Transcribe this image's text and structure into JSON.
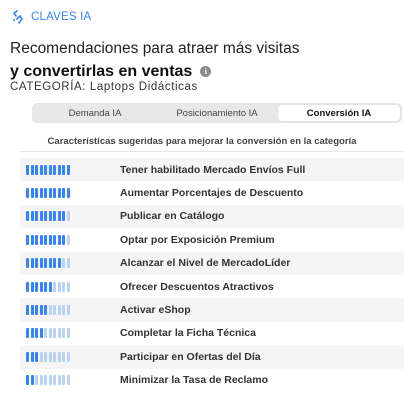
{
  "brand": {
    "label": "CLAVES IA",
    "icon": "ai-sparkle-icon",
    "color": "#3483fa"
  },
  "header": {
    "title_line1": "Recomendaciones para atraer más visitas",
    "title_line2": "y convertirlas en ventas",
    "info_icon": "info-icon"
  },
  "category": {
    "prefix": "CATEGORÍA:",
    "value": "Laptops Didácticas"
  },
  "tabs": [
    {
      "label": "Demanda IA",
      "active": false
    },
    {
      "label": "Posicionamiento IA",
      "active": false
    },
    {
      "label": "Conversión IA",
      "active": true
    }
  ],
  "section": {
    "subtitle": "Características sugeridas para mejorar la conversión en la categoría"
  },
  "bar_total": 10,
  "recommendations": [
    {
      "label": "Tener habilitado Mercado Envíos Full",
      "level": 10
    },
    {
      "label": "Aumentar Porcentajes de Descuento",
      "level": 10
    },
    {
      "label": "Publicar en Catálogo",
      "level": 9
    },
    {
      "label": "Optar por Exposición Premium",
      "level": 9
    },
    {
      "label": "Alcanzar el Nivel de MercadoLíder",
      "level": 8
    },
    {
      "label": "Ofrecer Descuentos Atractivos",
      "level": 6
    },
    {
      "label": "Activar eShop",
      "level": 5
    },
    {
      "label": "Completar la Ficha Técnica",
      "level": 4
    },
    {
      "label": "Participar en Ofertas del Día",
      "level": 3
    },
    {
      "label": "Minimizar la Tasa de Reclamo",
      "level": 2
    }
  ]
}
